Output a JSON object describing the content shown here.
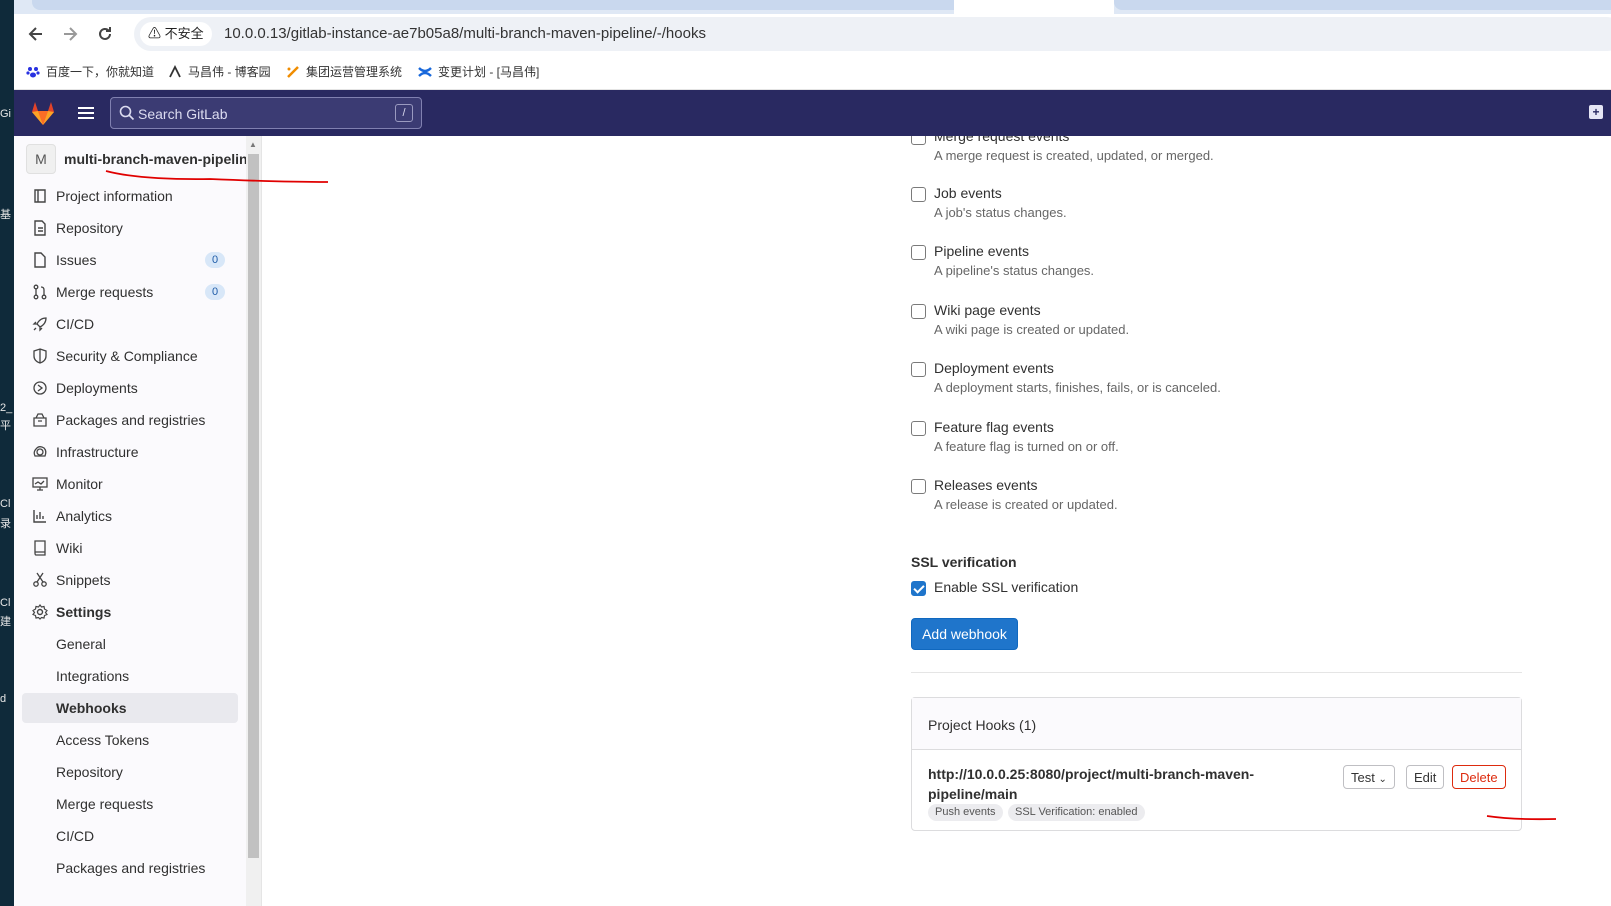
{
  "desktop": {
    "labels": [
      "Gi",
      "基",
      "2_",
      "平",
      "Cl",
      "录",
      "Cl",
      "建",
      "d"
    ]
  },
  "browser": {
    "security_label": "不安全",
    "url": "10.0.0.13/gitlab-instance-ae7b05a8/multi-branch-maven-pipeline/-/hooks",
    "bookmarks": [
      "百度一下，你就知道",
      "马昌伟 - 博客园",
      "集团运营管理系统",
      "变更计划 - [马昌伟]"
    ]
  },
  "header": {
    "search_placeholder": "Search GitLab",
    "search_shortcut": "/"
  },
  "sidebar": {
    "project_avatar": "M",
    "project_name": "multi-branch-maven-pipeline",
    "items": [
      {
        "label": "Project information",
        "icon": "project-icon"
      },
      {
        "label": "Repository",
        "icon": "document-icon"
      },
      {
        "label": "Issues",
        "icon": "issues-icon",
        "badge": "0"
      },
      {
        "label": "Merge requests",
        "icon": "merge-request-icon",
        "badge": "0"
      },
      {
        "label": "CI/CD",
        "icon": "rocket-icon"
      },
      {
        "label": "Security & Compliance",
        "icon": "shield-icon"
      },
      {
        "label": "Deployments",
        "icon": "deployments-icon"
      },
      {
        "label": "Packages and registries",
        "icon": "package-icon"
      },
      {
        "label": "Infrastructure",
        "icon": "cloud-gear-icon"
      },
      {
        "label": "Monitor",
        "icon": "monitor-icon"
      },
      {
        "label": "Analytics",
        "icon": "chart-icon"
      },
      {
        "label": "Wiki",
        "icon": "book-icon"
      },
      {
        "label": "Snippets",
        "icon": "scissors-icon"
      },
      {
        "label": "Settings",
        "icon": "gear-icon"
      }
    ],
    "settings_sub": [
      "General",
      "Integrations",
      "Webhooks",
      "Access Tokens",
      "Repository",
      "Merge requests",
      "CI/CD",
      "Packages and registries"
    ],
    "active": "Webhooks"
  },
  "main": {
    "events": [
      {
        "title": "Merge request events",
        "desc": "A merge request is created, updated, or merged."
      },
      {
        "title": "Job events",
        "desc": "A job's status changes."
      },
      {
        "title": "Pipeline events",
        "desc": "A pipeline's status changes."
      },
      {
        "title": "Wiki page events",
        "desc": "A wiki page is created or updated."
      },
      {
        "title": "Deployment events",
        "desc": "A deployment starts, finishes, fails, or is canceled."
      },
      {
        "title": "Feature flag events",
        "desc": "A feature flag is turned on or off."
      },
      {
        "title": "Releases events",
        "desc": "A release is created or updated."
      }
    ],
    "ssl": {
      "title": "SSL verification",
      "label": "Enable SSL verification",
      "checked": true
    },
    "add_webhook": "Add webhook",
    "hooks": {
      "title": "Project Hooks (1)",
      "url_line1": "http://10.0.0.25:8080/project/multi-branch-maven-",
      "url_line2": "pipeline/main",
      "tags": [
        "Push events",
        "SSL Verification: enabled"
      ],
      "buttons": {
        "test": "Test",
        "edit": "Edit",
        "delete": "Delete"
      }
    }
  },
  "colors": {
    "header": "#292961",
    "primary": "#1f75cb",
    "danger": "#dd2b0e",
    "annotation": "#e00000"
  }
}
